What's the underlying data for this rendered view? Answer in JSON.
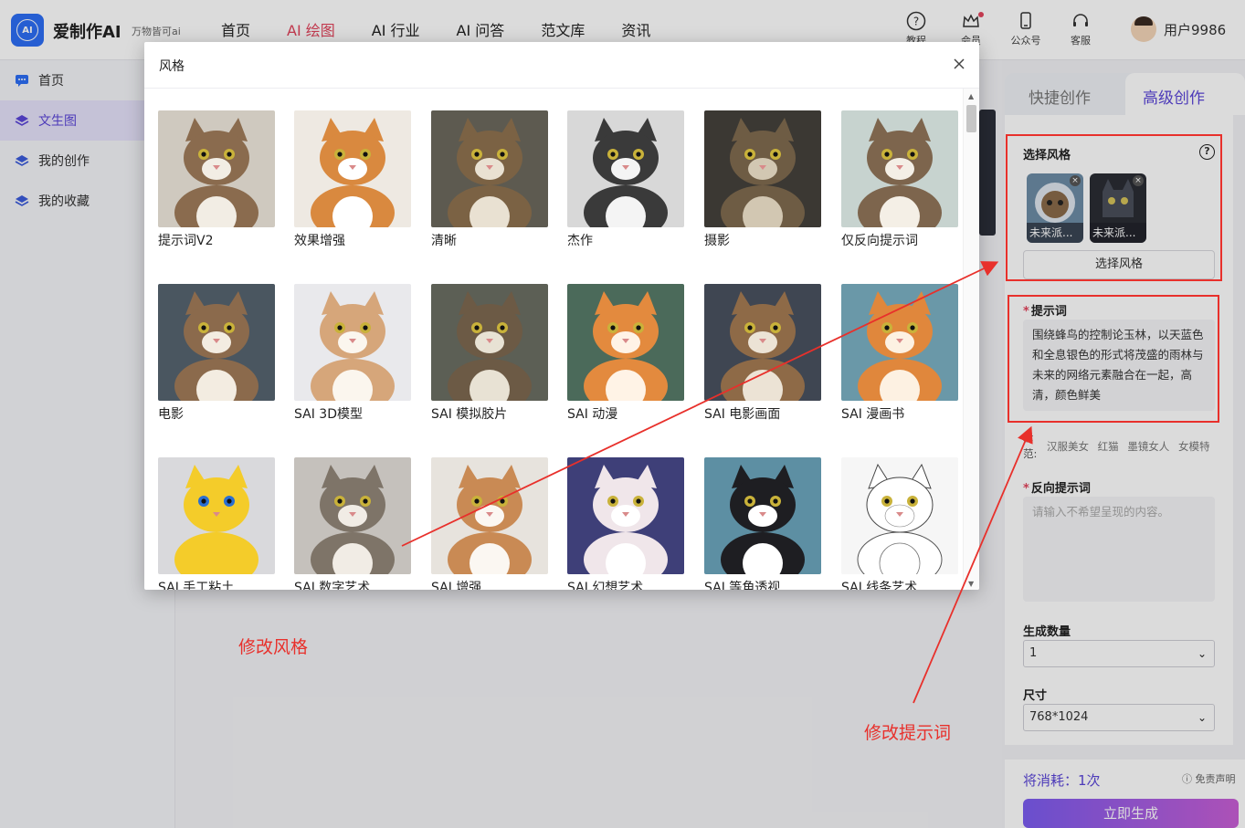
{
  "header": {
    "brand": "爱制作AI",
    "slogan": "万物皆可ai",
    "nav": [
      "首页",
      "AI 绘图",
      "AI 行业",
      "AI 问答",
      "范文库",
      "资讯"
    ],
    "active_nav_index": 1,
    "tools": [
      {
        "icon": "question-circle-icon",
        "label": "教程"
      },
      {
        "icon": "vip-crown-icon",
        "label": "会员"
      },
      {
        "icon": "phone-icon",
        "label": "公众号"
      },
      {
        "icon": "headset-icon",
        "label": "客服"
      }
    ],
    "username": "用户9986"
  },
  "sidebar": {
    "items": [
      {
        "label": "首页",
        "icon": "chat-icon"
      },
      {
        "label": "文生图",
        "icon": "layers-icon",
        "active": true
      },
      {
        "label": "我的创作",
        "icon": "layers-icon"
      },
      {
        "label": "我的收藏",
        "icon": "layers-icon"
      }
    ]
  },
  "modal": {
    "title": "风格",
    "styles": [
      {
        "label": "提示词V2"
      },
      {
        "label": "效果增强"
      },
      {
        "label": "清晰"
      },
      {
        "label": "杰作"
      },
      {
        "label": "摄影"
      },
      {
        "label": "仅反向提示词"
      },
      {
        "label": "电影"
      },
      {
        "label": "SAI 3D模型"
      },
      {
        "label": "SAI 模拟胶片"
      },
      {
        "label": "SAI 动漫"
      },
      {
        "label": "SAI 电影画面"
      },
      {
        "label": "SAI 漫画书"
      },
      {
        "label": "SAI 手工粘土"
      },
      {
        "label": "SAI 数字艺术"
      },
      {
        "label": "SAI 增强"
      },
      {
        "label": "SAI 幻想艺术"
      },
      {
        "label": "SAI 等角透视"
      },
      {
        "label": "SAI 线条艺术"
      }
    ]
  },
  "panel": {
    "tab_quick": "快捷创作",
    "tab_advanced": "高级创作",
    "style_label": "选择风格",
    "selected_styles": [
      "未来派...",
      "未来派..."
    ],
    "select_style_button": "选择风格",
    "prompt_label": "提示词",
    "prompt_value": "围绕蜂鸟的控制论玉林，以天蓝色和全息银色的形式将茂盛的雨林与未来的网络元素融合在一起，高清，颜色鲜美",
    "examples_label": "示范:",
    "examples": [
      "汉服美女",
      "红猫",
      "墨镜女人",
      "女模特"
    ],
    "negative_label": "反向提示词",
    "negative_placeholder": "请输入不希望呈现的内容。",
    "count_label": "生成数量",
    "count_value": "1",
    "size_label": "尺寸",
    "size_value": "768*1024",
    "consume_text": "将消耗：1次",
    "disclaimer": "免责声明",
    "generate_button": "立即生成"
  },
  "annotations": {
    "modify_style": "修改风格",
    "modify_prompt": "修改提示词"
  },
  "colors": {
    "accent_purple": "#5a45d8",
    "nav_active": "#e2445c",
    "annotation_red": "#e8302b",
    "brand_blue": "#2d6ef5"
  }
}
